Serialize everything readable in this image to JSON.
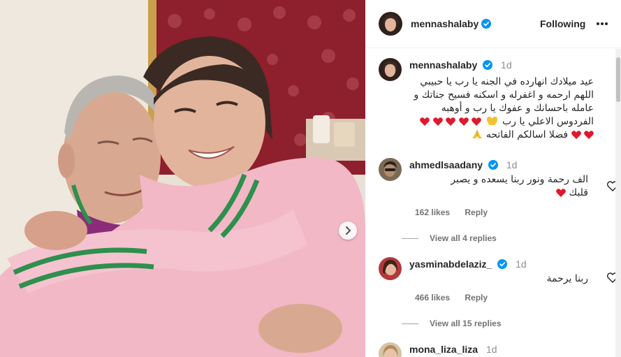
{
  "post": {
    "username": "mennashalaby",
    "follow_label": "Following",
    "more_label": "More options"
  },
  "caption": {
    "username": "mennashalaby",
    "time": "1d",
    "line1": "عيد ميلادك انهارده في الجنه يا رب يا حبيبي",
    "line2": "اللهم ارحمه و اغفرله و اسكنه فسيح جناتك و",
    "line3": "عامله باحسانك و عفوك يا رب و أوهبه",
    "line4": "الفردوس الاعلي يا رب",
    "line5": "فضلا اسالكم الفاتحه"
  },
  "comments": [
    {
      "username": "ahmedlsaadany",
      "time": "1d",
      "text_line1": "الف رحمة ونور ربنا يسعده و يصبر",
      "text_line2": "قلبك",
      "likes": "162 likes",
      "reply": "Reply",
      "view_replies": "View all 4 replies"
    },
    {
      "username": "yasminabdelaziz_",
      "time": "1d",
      "text_line1": "ربنا يرحمة",
      "likes": "466 likes",
      "reply": "Reply",
      "view_replies": "View all 15 replies"
    },
    {
      "username": "mona_liza_liza",
      "time": "1d"
    }
  ],
  "colors": {
    "verified": "#0095f6",
    "heart_red": "#e0182d",
    "jacket_pink": "#f2b8c6",
    "stripe_green": "#2f8f4e"
  }
}
